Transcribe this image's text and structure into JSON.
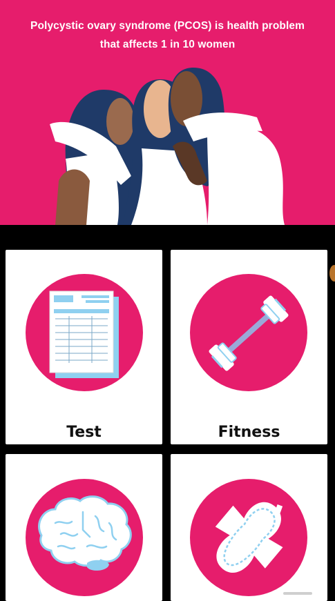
{
  "banner": {
    "headline": "Polycystic ovary syndrome (PCOS) is health problem that affects 1 in 10 women",
    "illustration": "three-women-hugging-illustration"
  },
  "menu": {
    "tiles": [
      {
        "label": "Test",
        "icon": "test-report-icon"
      },
      {
        "label": "Fitness",
        "icon": "dumbbell-icon"
      },
      {
        "label": "",
        "icon": "brain-icon"
      },
      {
        "label": "",
        "icon": "sanitary-pad-icon"
      }
    ]
  },
  "colors": {
    "accent": "#e61d6c",
    "tile_background": "#ffffff",
    "page_background": "#000000",
    "icon_blue": "#8fd0f0"
  }
}
